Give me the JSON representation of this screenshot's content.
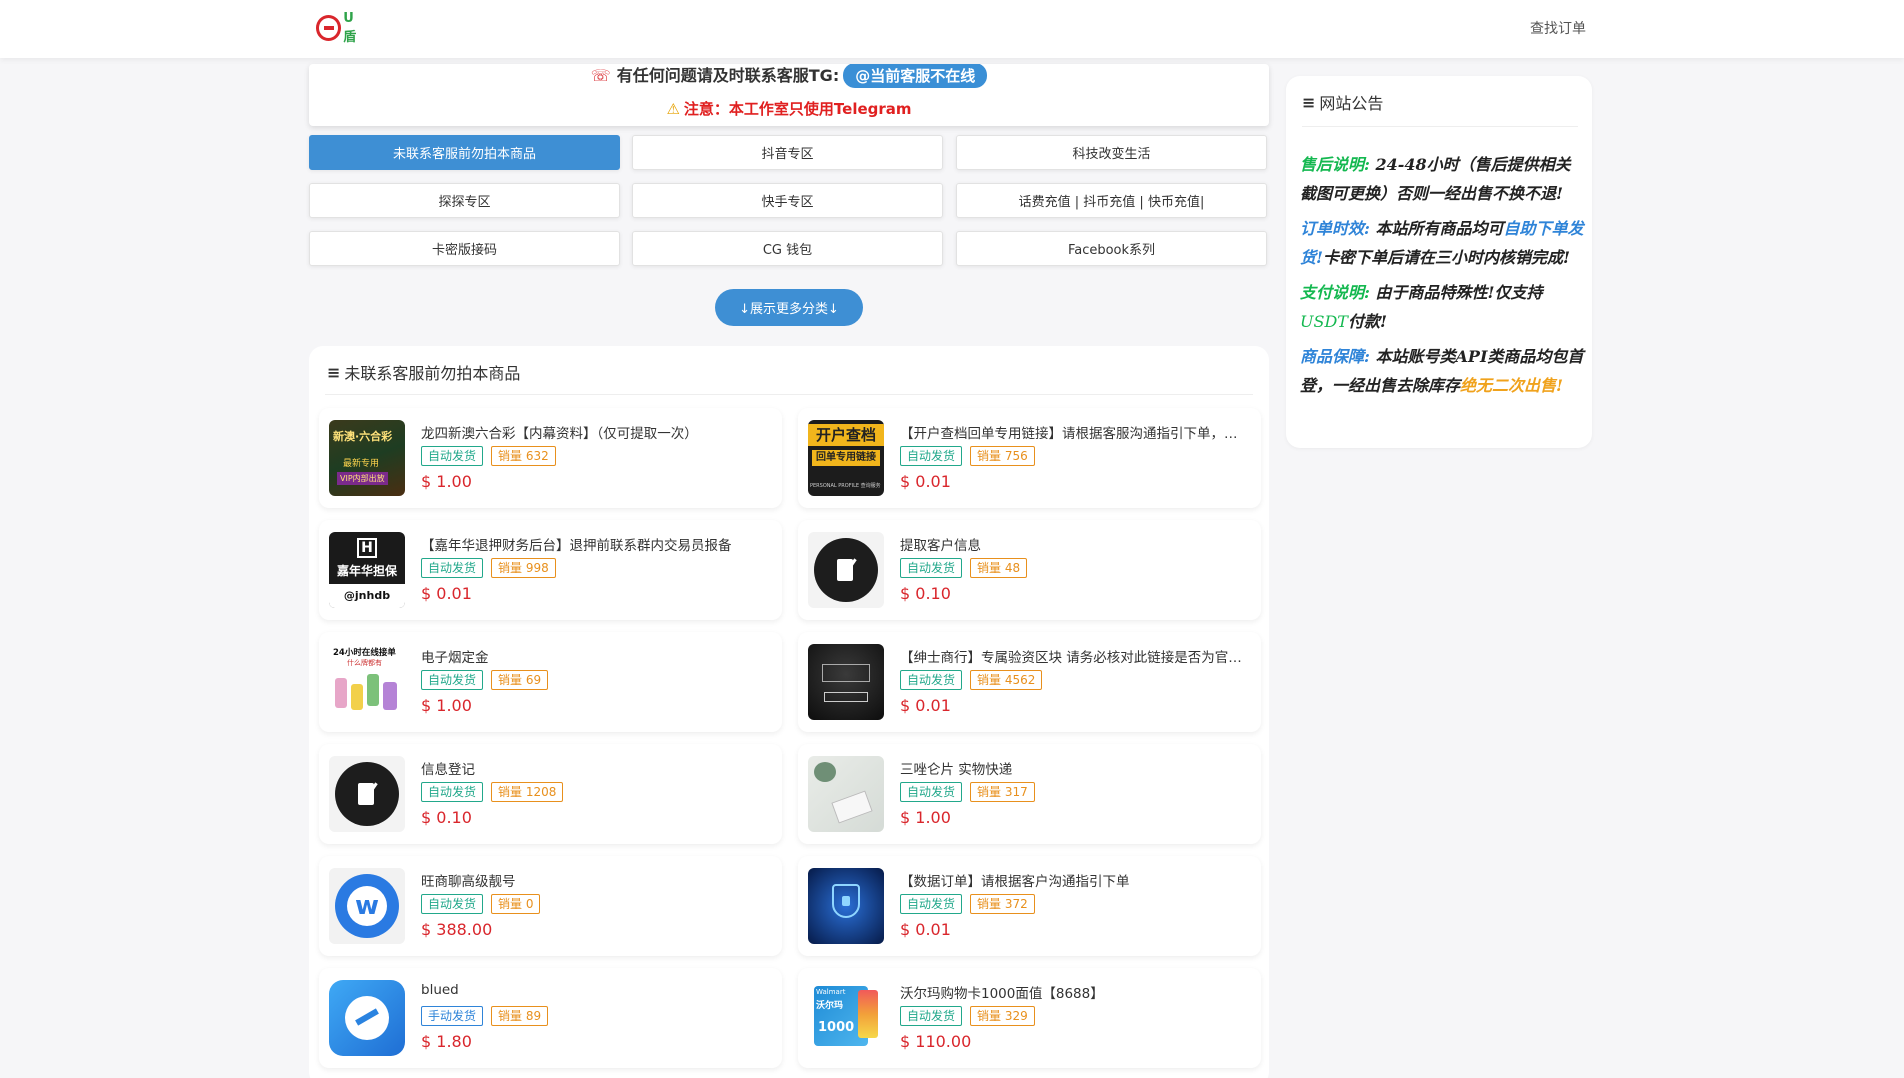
{
  "header": {
    "find_order": "查找订单"
  },
  "notice": {
    "contact_text": "有任何问题请及时联系客服TG:",
    "tg_status": "@当前客服不在线",
    "warning_text": "注意：本工作室只使用Telegram"
  },
  "categories": [
    {
      "label": "未联系客服前勿拍本商品",
      "active": true
    },
    {
      "label": "抖音专区"
    },
    {
      "label": "科技改变生活"
    },
    {
      "label": "探探专区"
    },
    {
      "label": "快手专区"
    },
    {
      "label": "话费充值 | 抖币充值 | 快币充值|"
    },
    {
      "label": "卡密版接码"
    },
    {
      "label": "CG 钱包"
    },
    {
      "label": "Facebook系列"
    }
  ],
  "more_categories": "↓展示更多分类↓",
  "products_section": {
    "title": "未联系客服前勿拍本商品",
    "items": [
      {
        "name": "龙四新澳六合彩【内幕资料】（仅可提取一次）",
        "delivery": "自动发货",
        "sales": "销量 632",
        "price": "$ 1.00"
      },
      {
        "name": "【开户查档回单专用链接】请根据客服沟通指引下单，请勿私自下单",
        "delivery": "自动发货",
        "sales": "销量 756",
        "price": "$ 0.01"
      },
      {
        "name": "【嘉年华退押财务后台】退押前联系群内交易员报备",
        "delivery": "自动发货",
        "sales": "销量 998",
        "price": "$ 0.01"
      },
      {
        "name": "提取客户信息",
        "delivery": "自动发货",
        "sales": "销量 48",
        "price": "$ 0.10"
      },
      {
        "name": "电子烟定金",
        "delivery": "自动发货",
        "sales": "销量 69",
        "price": "$ 1.00"
      },
      {
        "name": "【绅士商行】专属验资区块 请务必核对此链接是否为官方发布",
        "delivery": "自动发货",
        "sales": "销量 4562",
        "price": "$ 0.01"
      },
      {
        "name": "信息登记",
        "delivery": "自动发货",
        "sales": "销量 1208",
        "price": "$ 0.10"
      },
      {
        "name": "三唑仑片 实物快递",
        "delivery": "自动发货",
        "sales": "销量 317",
        "price": "$ 1.00"
      },
      {
        "name": "旺商聊高级靓号",
        "delivery": "自动发货",
        "sales": "销量 0",
        "price": "$ 388.00"
      },
      {
        "name": "【数据订单】请根据客户沟通指引下单",
        "delivery": "自动发货",
        "sales": "销量 372",
        "price": "$ 0.01"
      },
      {
        "name": "blued",
        "delivery": "手动发货",
        "sales": "销量 89",
        "price": "$ 1.80"
      },
      {
        "name": "沃尔玛购物卡1000面值【8688】",
        "delivery": "自动发货",
        "sales": "销量 329",
        "price": "$ 110.00"
      }
    ]
  },
  "thumb_texts": {
    "t1_top": "新澳·六合彩",
    "t1_mid": "最新专用",
    "t1_bot": "VIP内部出放",
    "t2_top": "开户查档",
    "t2_mid": "回单专用链接",
    "t2_bot": "PERSONAL PROFILE 查询服务",
    "t3_top": "嘉年华担保",
    "t3_bot": "@jnhdb",
    "t5_top": "24小时在线接单",
    "t5_mid": "什么牌都有",
    "t12_top": "Walmart",
    "t12_mid": "沃尔玛",
    "t12_bot": "1000"
  },
  "announcement": {
    "title": "网站公告",
    "after_sales_label": "售后说明:",
    "after_sales_text1": " 24-48小时（售后提供相关截图可更换）否则一经出售不换不退!",
    "order_label": "订单时效:",
    "order_text1": " 本站所有商品均可",
    "order_highlight": "自助下单发货!",
    "order_text2": "卡密下单后请在三小时内核销完成!",
    "payment_label": "支付说明:",
    "payment_text1": " 由于商品特殊性!仅支持",
    "payment_usdt": "USDT",
    "payment_text2": "付款!",
    "guarantee_label": "商品保障:",
    "guarantee_text1": " 本站账号类API类商品均包首登，一经出售去除库存",
    "guarantee_highlight": "绝无二次出售!"
  }
}
